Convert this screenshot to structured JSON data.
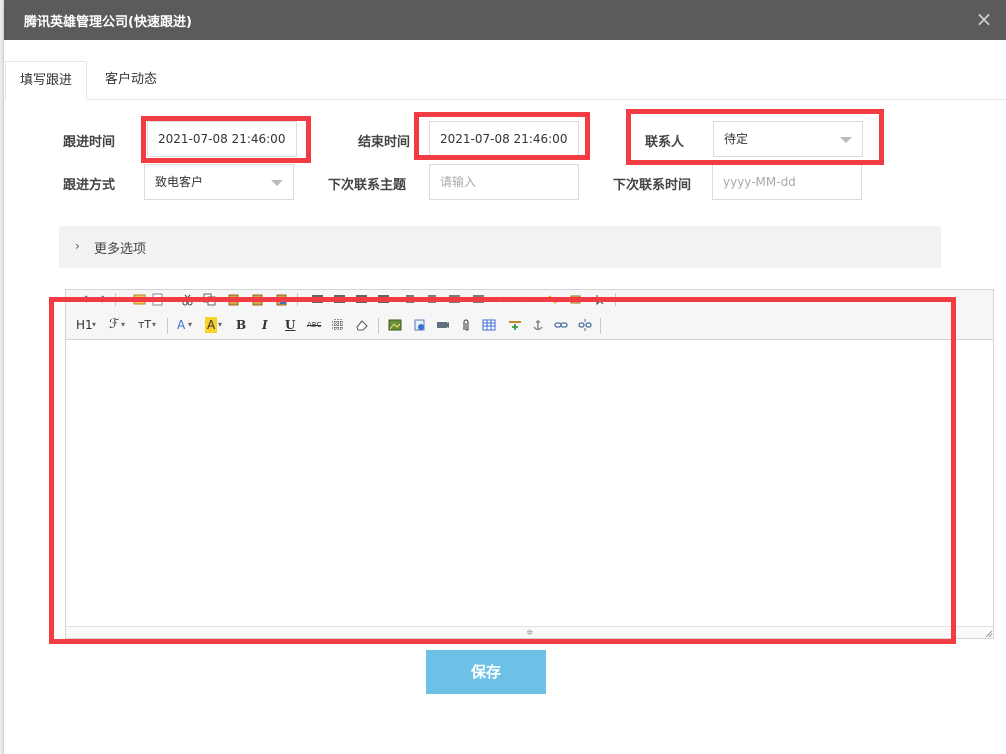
{
  "dialog": {
    "title": "腾讯英雄管理公司(快速跟进)",
    "close_glyph": "×"
  },
  "tabs": [
    {
      "label": "填写跟进",
      "active": true
    },
    {
      "label": "客户动态",
      "active": false
    }
  ],
  "form": {
    "follow_time": {
      "label": "跟进时间",
      "value": "2021-07-08 21:46:00"
    },
    "end_time": {
      "label": "结束时间",
      "value": "2021-07-08 21:46:00"
    },
    "contact": {
      "label": "联系人",
      "value": "待定"
    },
    "follow_method": {
      "label": "跟进方式",
      "value": "致电客户"
    },
    "next_subject": {
      "label": "下次联系主题",
      "placeholder": "请输入"
    },
    "next_time": {
      "label": "下次联系时间",
      "placeholder": "yyyy-MM-dd"
    }
  },
  "more_options": {
    "label": "更多选项",
    "chevron": "›"
  },
  "editor_toolbar": {
    "heading": "H1",
    "font_family": "ℱ",
    "font_size": "ᴛT",
    "font_color": "A",
    "bg_color": "A",
    "bold": "B",
    "italic": "I",
    "underline": "U",
    "strikethrough": "ABC"
  },
  "save_label": "保存",
  "colors": {
    "titlebar": "#5b5b5b",
    "highlight_box": "#f13c44",
    "save_button": "#6ec1e6"
  }
}
